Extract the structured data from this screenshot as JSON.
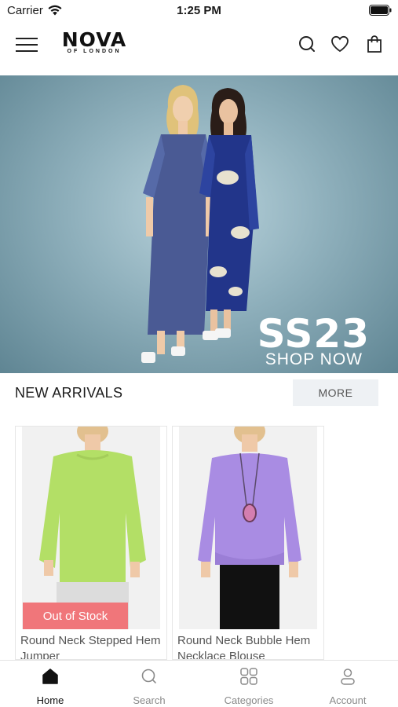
{
  "status_bar": {
    "carrier": "Carrier",
    "time": "1:25 PM"
  },
  "header": {
    "brand_name": "NOVA",
    "brand_sub": "OF LONDON",
    "icons": [
      "menu-icon",
      "search-icon",
      "heart-icon",
      "shopping-bag-icon"
    ]
  },
  "hero": {
    "title": "SS23",
    "cta": "SHOP NOW"
  },
  "new_arrivals": {
    "title": "NEW ARRIVALS",
    "more_label": "MORE",
    "products": [
      {
        "name": "Round Neck Stepped Hem Jumper",
        "badge": "Out of Stock",
        "color": "#b7e06a"
      },
      {
        "name": "Round Neck Bubble Hem Necklace Blouse",
        "badge": "",
        "color": "#a98ce3"
      }
    ]
  },
  "tab_bar": {
    "tabs": [
      {
        "label": "Home",
        "icon": "home-icon",
        "active": true
      },
      {
        "label": "Search",
        "icon": "search-icon",
        "active": false
      },
      {
        "label": "Categories",
        "icon": "grid-icon",
        "active": false
      },
      {
        "label": "Account",
        "icon": "user-icon",
        "active": false
      }
    ]
  },
  "colors": {
    "badge": "#f0767a",
    "more_bg": "#eef1f4",
    "hero_bg": "#8fb0bc"
  }
}
